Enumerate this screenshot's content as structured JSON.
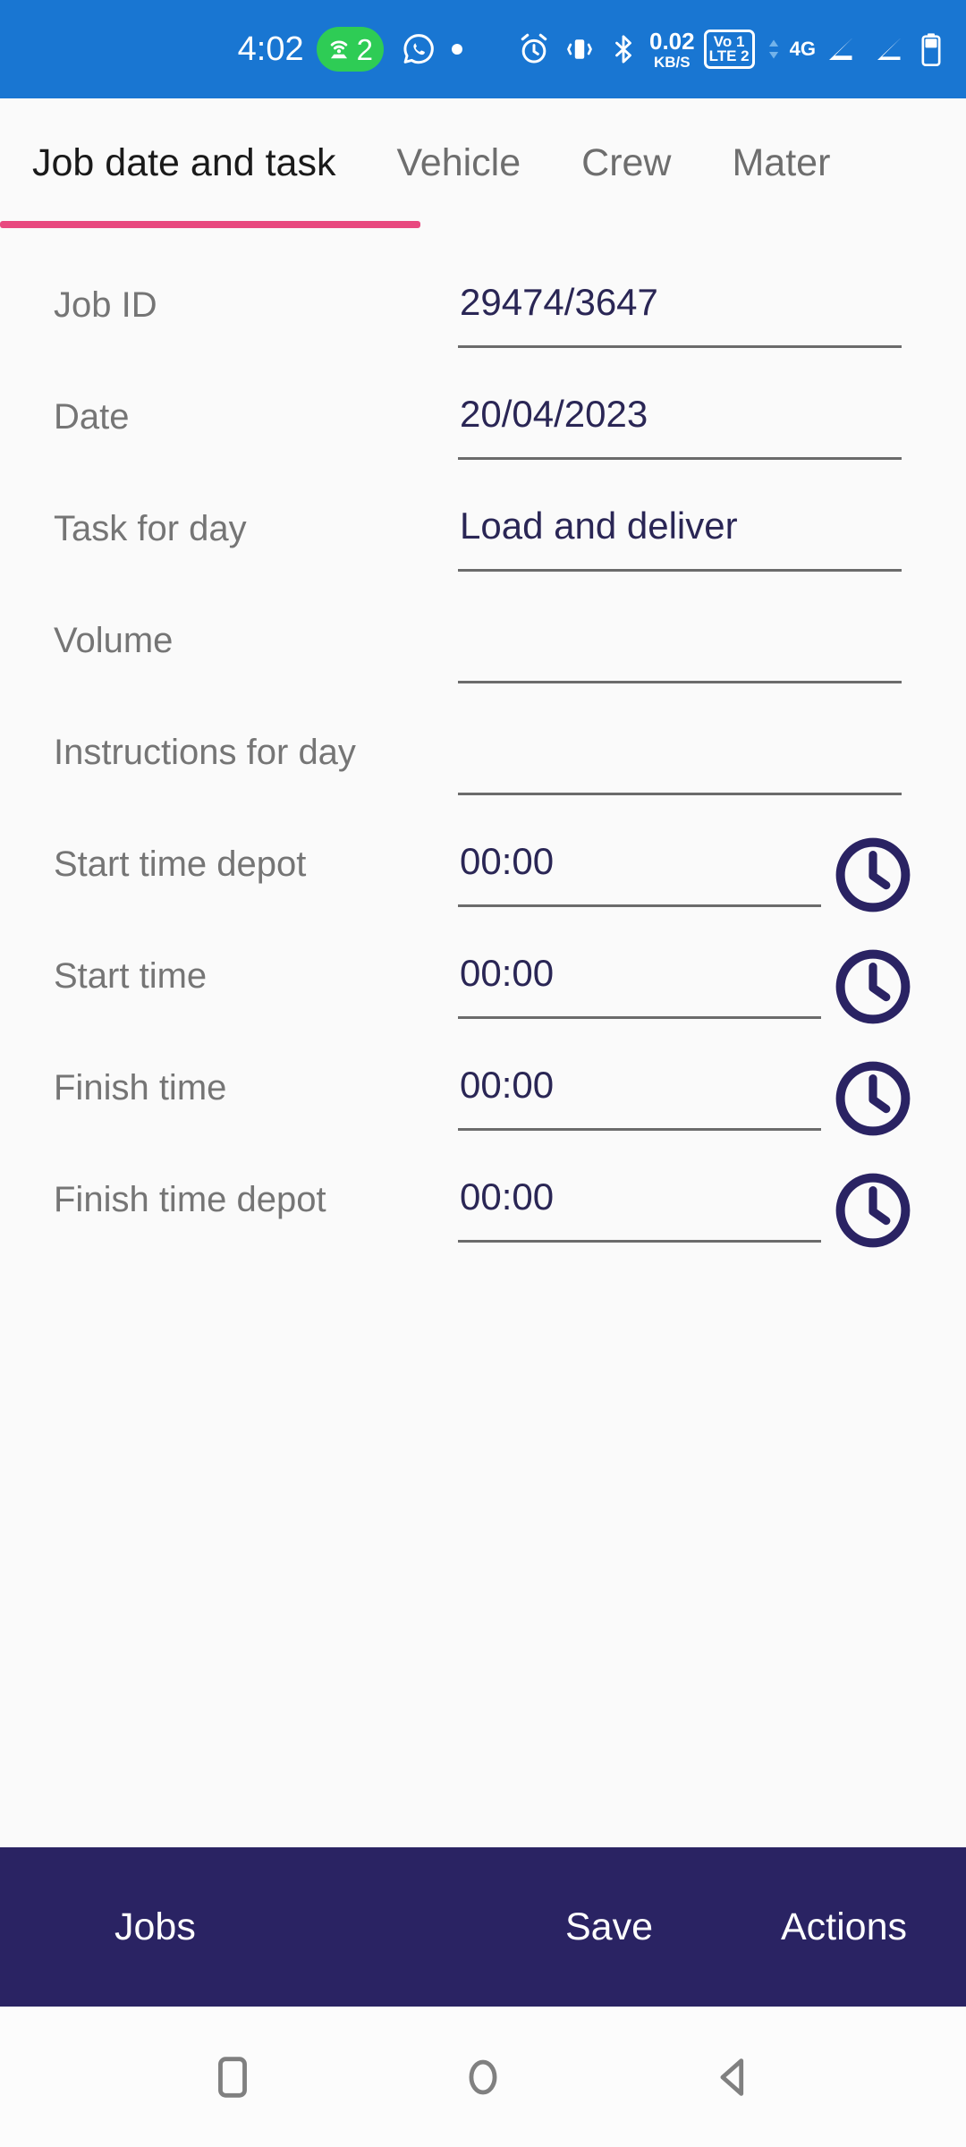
{
  "status_bar": {
    "time": "4:02",
    "hotspot_count": "2",
    "network_speed_value": "0.02",
    "network_speed_unit": "KB/S",
    "volte_line1": "Vo 1",
    "volte_line2": "LTE 2",
    "network_type": "4G",
    "background_color": "#1976D2",
    "hotspot_color": "#2ECC55",
    "icons": [
      "hotspot-icon",
      "whatsapp-icon",
      "dot-indicator-icon",
      "alarm-icon",
      "vibrate-icon",
      "bluetooth-icon",
      "data-speed-icon",
      "volte-icon",
      "signal-1-icon",
      "signal-2-icon",
      "battery-icon"
    ]
  },
  "tabs": {
    "active_index": 0,
    "indicator_color": "#E8497F",
    "items": [
      {
        "label": "Job date and task"
      },
      {
        "label": "Vehicle"
      },
      {
        "label": "Crew"
      },
      {
        "label": "Mater"
      }
    ]
  },
  "form": {
    "fields": [
      {
        "label": "Job ID",
        "value": "29474/3647",
        "placeholder": "",
        "has_clock": false
      },
      {
        "label": "Date",
        "value": "20/04/2023",
        "placeholder": "",
        "has_clock": false
      },
      {
        "label": "Task for day",
        "value": "Load and deliver",
        "placeholder": "",
        "has_clock": false
      },
      {
        "label": "Volume",
        "value": "",
        "placeholder": "",
        "has_clock": false
      },
      {
        "label": "Instructions for day",
        "value": "",
        "placeholder": "",
        "has_clock": false
      },
      {
        "label": "Start time depot",
        "value": "00:00",
        "placeholder": "",
        "has_clock": true
      },
      {
        "label": "Start time",
        "value": "00:00",
        "placeholder": "",
        "has_clock": true
      },
      {
        "label": "Finish time",
        "value": "00:00",
        "placeholder": "",
        "has_clock": true
      },
      {
        "label": "Finish time depot",
        "value": "00:00",
        "placeholder": "",
        "has_clock": true
      }
    ],
    "value_color": "#2A2655",
    "label_color": "#757575",
    "underline_color": "#6B6B6B",
    "clock_icon_color": "#2A2363"
  },
  "action_bar": {
    "background_color": "#2A2363",
    "buttons": [
      {
        "label": "Jobs"
      },
      {
        "label": "Save"
      },
      {
        "label": "Actions"
      }
    ]
  },
  "nav_bar": {
    "keys": [
      "recents-square-icon",
      "home-circle-icon",
      "back-triangle-icon"
    ],
    "icon_color": "#808080"
  }
}
